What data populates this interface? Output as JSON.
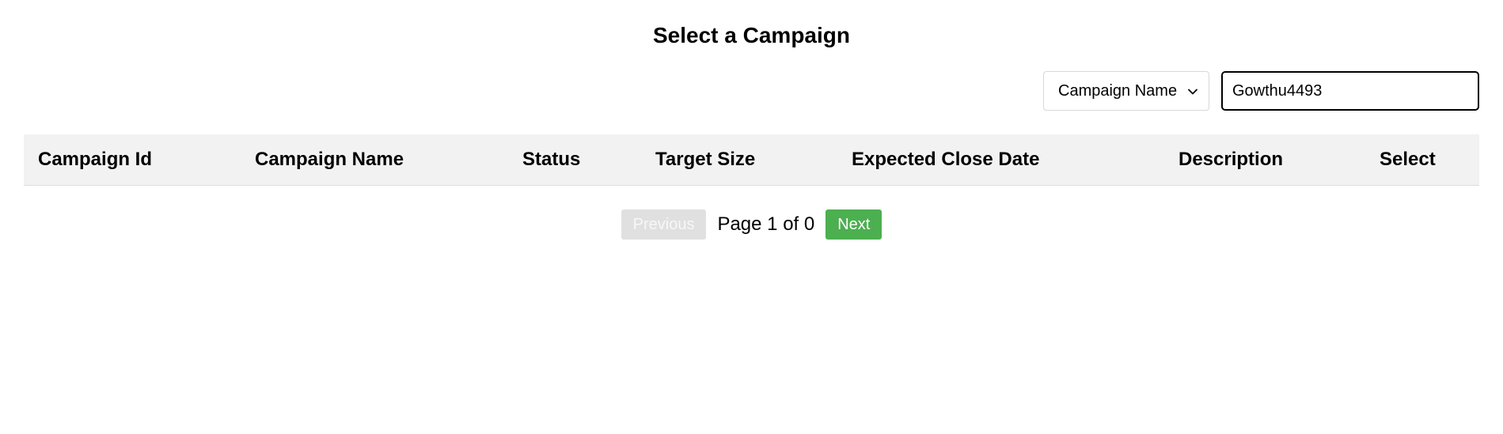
{
  "header": {
    "title": "Select a Campaign"
  },
  "filter": {
    "selected": "Campaign Name",
    "search_value": "Gowthu4493"
  },
  "table": {
    "columns": [
      "Campaign Id",
      "Campaign Name",
      "Status",
      "Target Size",
      "Expected Close Date",
      "Description",
      "Select"
    ],
    "rows": []
  },
  "pagination": {
    "previous_label": "Previous",
    "page_info": "Page 1 of 0",
    "next_label": "Next"
  },
  "colors": {
    "next_button": "#4caf50",
    "previous_button_disabled": "#e0e0e0",
    "header_background": "#f2f2f2"
  },
  "icons": {
    "select_arrow": "chevron-down-icon"
  }
}
